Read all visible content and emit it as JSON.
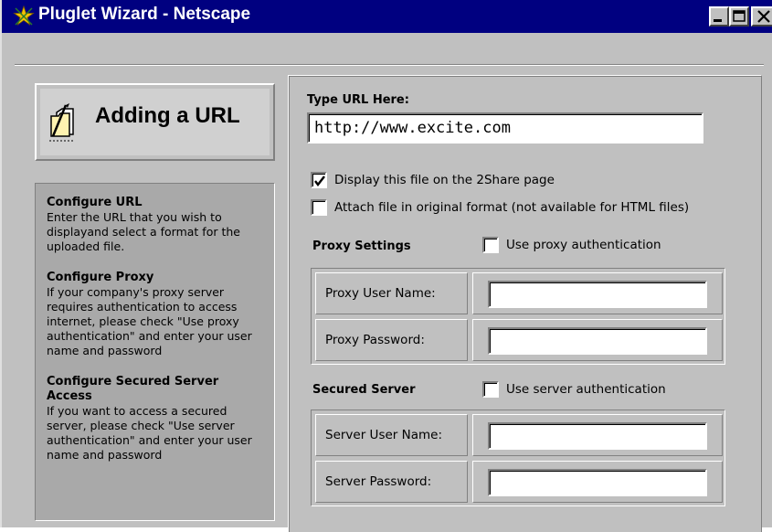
{
  "window": {
    "title": "Pluglet Wizard - Netscape",
    "colors": {
      "titlebar": "#000080",
      "face": "#c0c0c0",
      "help_panel": "#a9a9a9"
    }
  },
  "header": {
    "title": "Adding a URL",
    "icon": "folder-pen-icon"
  },
  "help": {
    "sections": [
      {
        "heading": "Configure URL",
        "body": "Enter the URL that you wish to displayand select a format for the uploaded file."
      },
      {
        "heading": "Configure Proxy",
        "body": "If your company's proxy server requires authentication to access internet, please check \"Use proxy authentication\" and enter your user name and password"
      },
      {
        "heading": "Configure Secured Server Access",
        "body": "If you want to access a secured server, please check \"Use server authentication\" and enter your user name and password"
      }
    ]
  },
  "url": {
    "label": "Type URL Here:",
    "value": "http://www.excite.com"
  },
  "options": {
    "display_on_2share": {
      "label": "Display this file on the 2Share page",
      "checked": true
    },
    "attach_original": {
      "label": "Attach file in original format (not available for HTML files)",
      "checked": false
    }
  },
  "proxy": {
    "heading": "Proxy Settings",
    "use_auth_label": "Use proxy authentication",
    "use_auth_checked": false,
    "user_label": "Proxy User Name:",
    "user_value": "",
    "password_label": "Proxy Password:",
    "password_value": ""
  },
  "server": {
    "heading": "Secured Server",
    "use_auth_label": "Use server authentication",
    "use_auth_checked": false,
    "user_label": "Server User Name:",
    "user_value": "",
    "password_label": "Server Password:",
    "password_value": ""
  }
}
